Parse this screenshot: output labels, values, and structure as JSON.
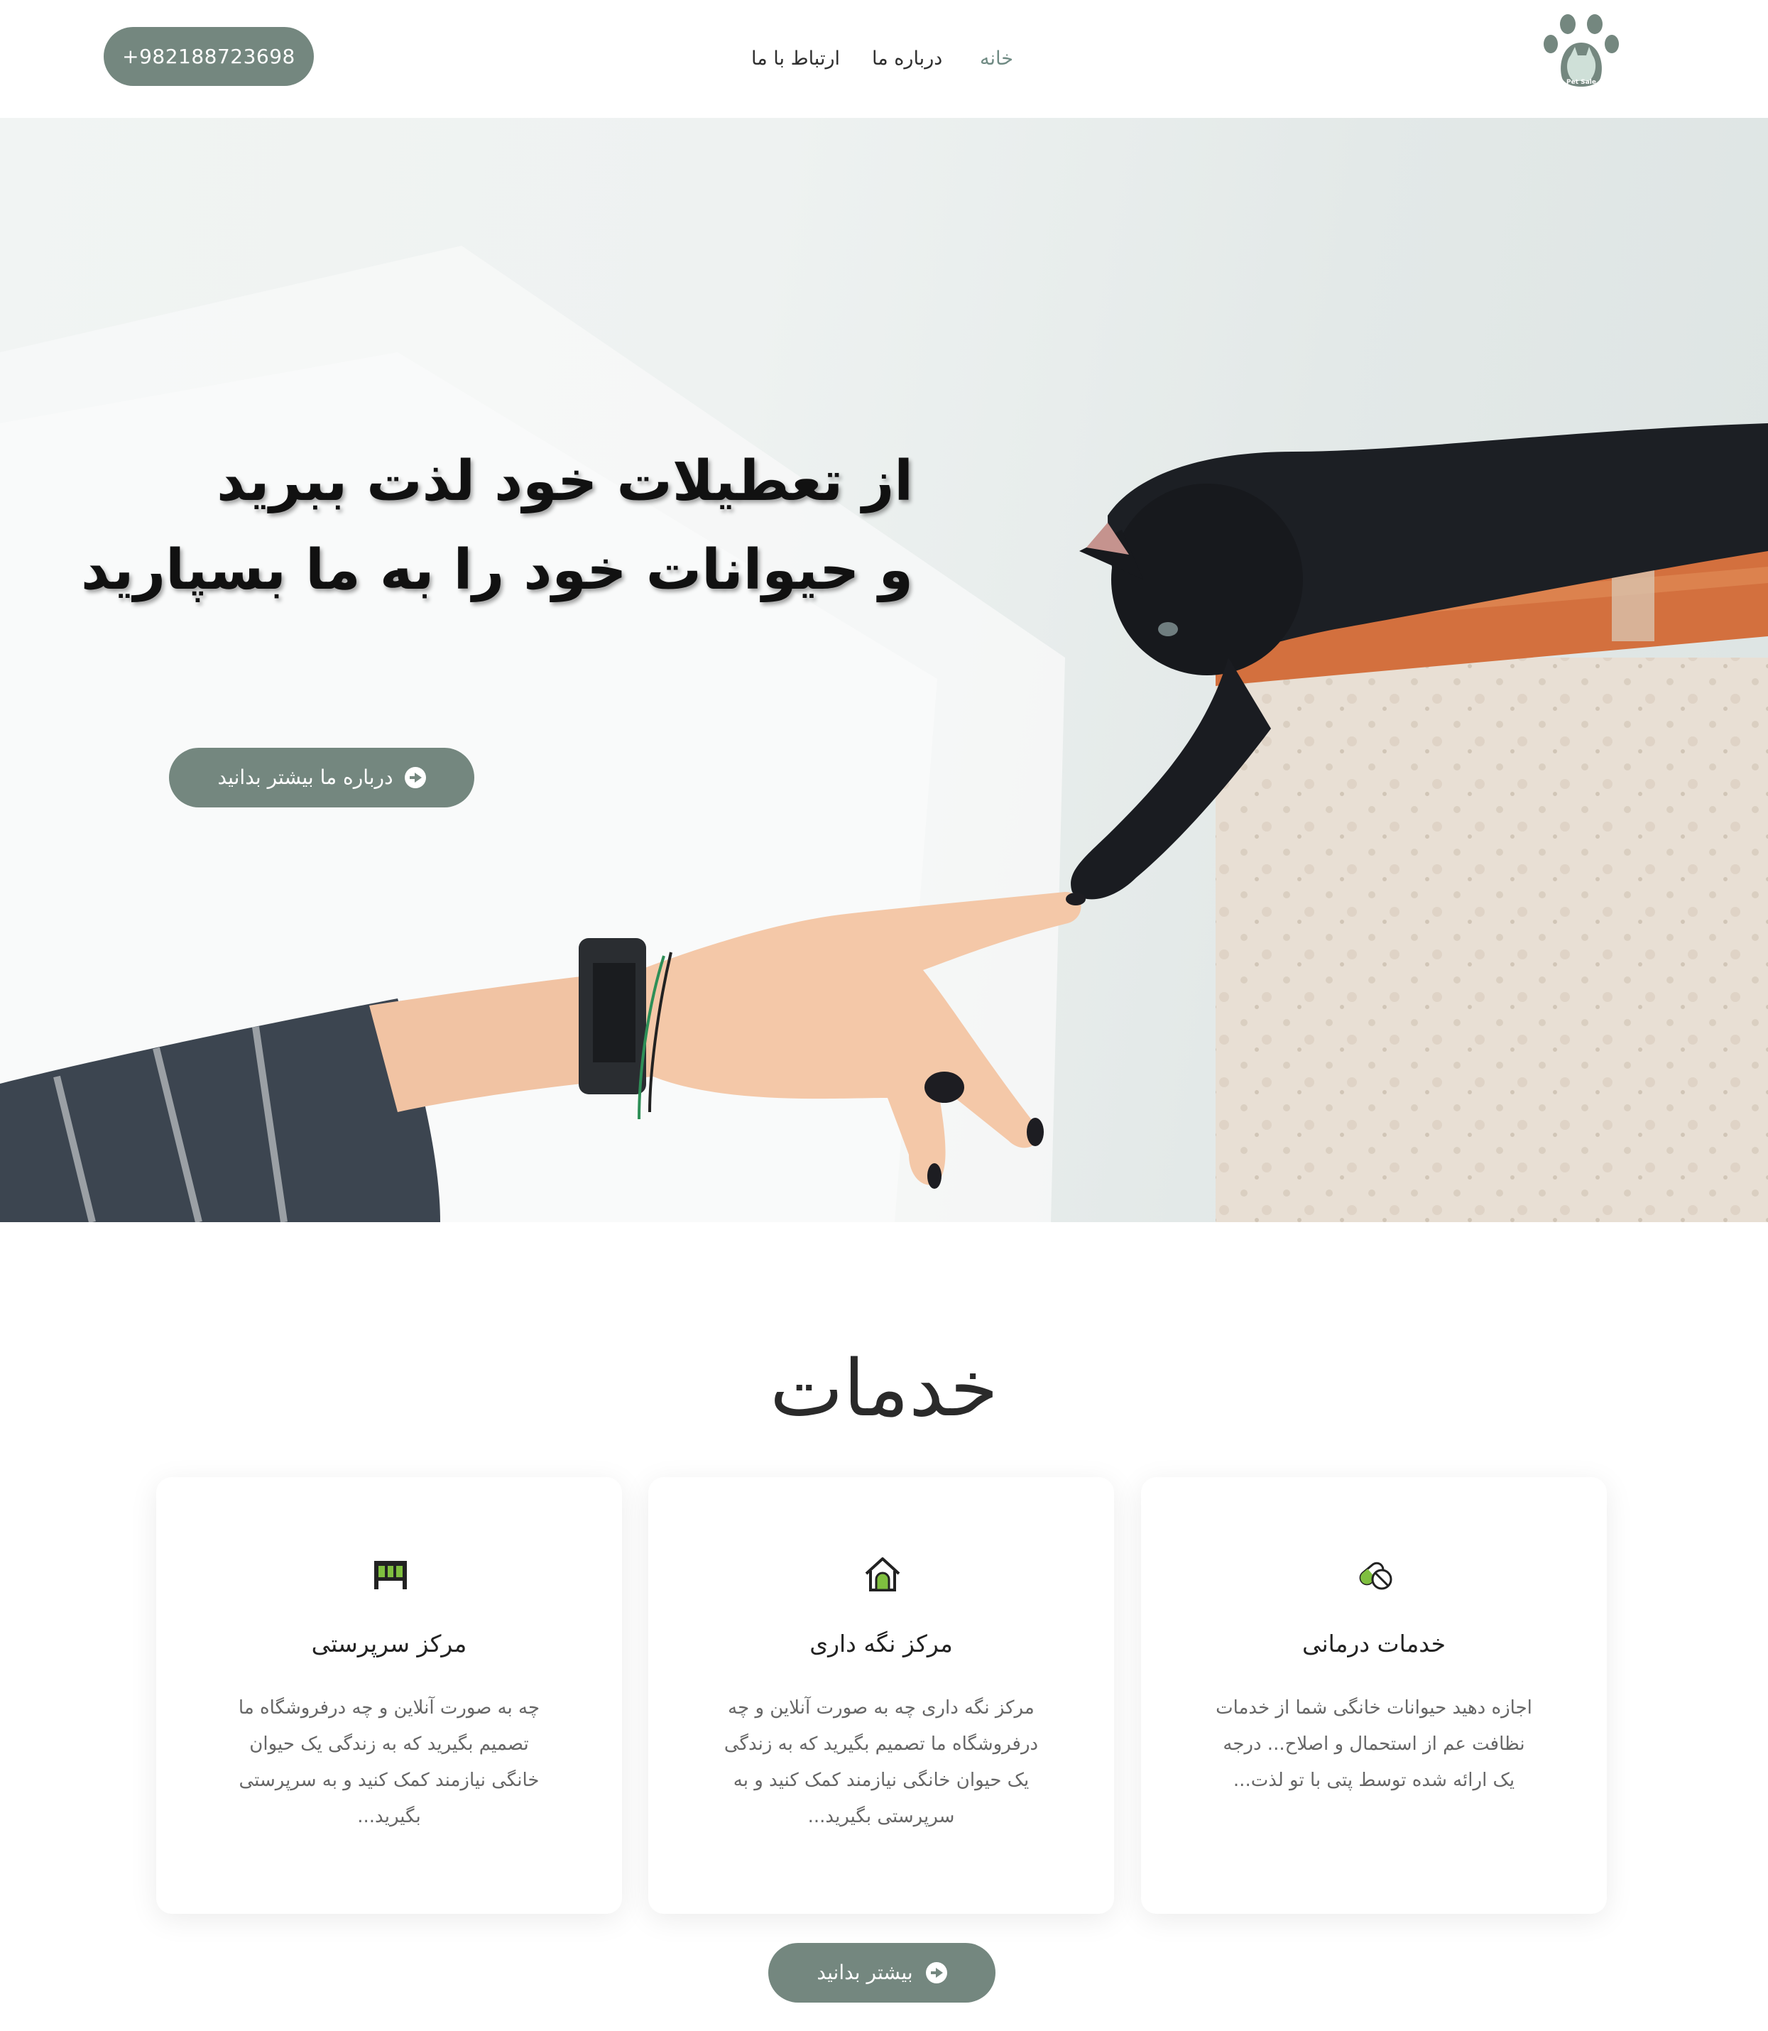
{
  "header": {
    "logo_text": "Pet Sale",
    "nav": [
      {
        "label": "خانه",
        "active": true
      },
      {
        "label": "درباره ما",
        "active": false
      },
      {
        "label": "ارتباط با ما",
        "active": false
      }
    ],
    "phone": "+982188723698"
  },
  "hero": {
    "title_line1": "از تعطیلات خود لذت ببرید",
    "title_line2": "و حیوانات خود را به ما بسپارید",
    "cta_label": "درباره ما بیشتر بدانید",
    "cta_icon": "arrow-circle-right-icon"
  },
  "services": {
    "title": "خدمات",
    "cards": [
      {
        "icon": "pills-icon",
        "title": "خدمات درمانی",
        "text": "اجازه دهید حیوانات خانگی شما از خدمات نظافت عم از استحمال و اصلاح... درجه یک ارائه شده توسط پتی با تو لذت..."
      },
      {
        "icon": "house-icon",
        "title": "مرکز نگه داری",
        "text": "مرکز نگه داری چه به صورت آنلاین و چه درفروشگاه ما تصمیم بگیرید که به زندگی یک حیوان خانگی نیازمند کمک کنید و به سرپرستی بگیرید..."
      },
      {
        "icon": "fence-icon",
        "title": "مرکز سرپرستی",
        "text": "چه به صورت آنلاین و چه درفروشگاه ما تصمیم بگیرید که به زندگی یک حیوان خانگی نیازمند کمک کنید و به سرپرستی بگیرید..."
      }
    ],
    "more_label": "بیشتر بدانید"
  },
  "colors": {
    "accent": "#74877f",
    "active_nav": "#6f8a83",
    "icon_green": "#7fbf3f"
  }
}
